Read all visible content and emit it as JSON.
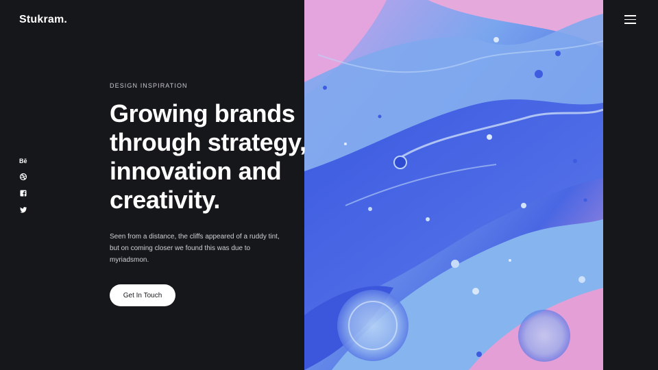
{
  "brand": {
    "logo": "Stukram."
  },
  "header": {
    "menu_icon": "hamburger-menu-icon"
  },
  "social": [
    {
      "name": "behance",
      "icon": "behance-icon",
      "glyph": "Bē"
    },
    {
      "name": "dribbble",
      "icon": "dribbble-icon"
    },
    {
      "name": "facebook",
      "icon": "facebook-icon"
    },
    {
      "name": "twitter",
      "icon": "twitter-icon"
    }
  ],
  "hero": {
    "eyebrow": "DESIGN INSPIRATION",
    "headline": "Growing brands through strategy, innovation and creativity.",
    "description": "Seen from a distance, the cliffs appeared of a ruddy tint, but on coming closer we found this was due to myriadsmon.",
    "cta_label": "Get In Touch"
  },
  "artwork": {
    "description": "abstract fluid art",
    "colors": [
      "#6a8de8",
      "#3f5fe0",
      "#e8a3d8",
      "#7fb2ee"
    ]
  },
  "colors": {
    "background": "#16171b",
    "text": "#ffffff",
    "button_bg": "#ffffff"
  }
}
